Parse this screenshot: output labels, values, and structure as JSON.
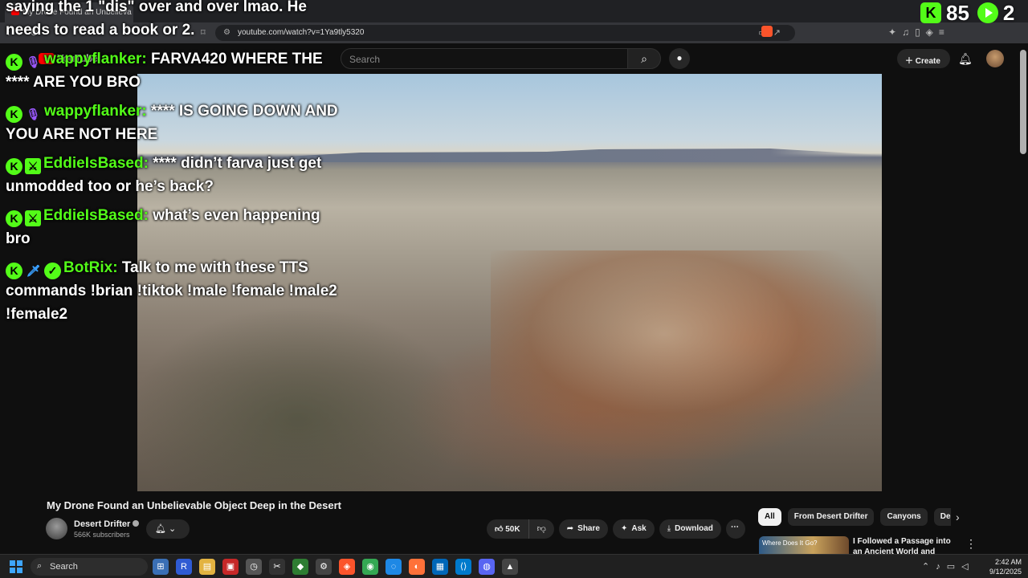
{
  "browser": {
    "tab_title": "My Drone Found an Unbelieva",
    "url": "youtube.com/watch?v=1Ya9tly5320"
  },
  "youtube": {
    "logo_text": "YouTube",
    "search_placeholder": "Search",
    "create_label": "Create"
  },
  "chat": {
    "messages": [
      {
        "badges": [],
        "user": "",
        "text": "saying the 1 \"dis\" over and over lmao. He needs to read a book or 2."
      },
      {
        "badges": [
          "kick-badge",
          "mic-badge"
        ],
        "user": "wappyflanker:",
        "text": "FARVA420 WHERE THE **** ARE YOU BRO"
      },
      {
        "badges": [
          "kick-badge",
          "mic-badge"
        ],
        "user": "wappyflanker:",
        "text": "**** IS GOING DOWN AND YOU ARE NOT HERE"
      },
      {
        "badges": [
          "kick-badge",
          "moderator-badge"
        ],
        "user": "EddieIsBased:",
        "text": "**** didn’t farva just get unmodded too or he’s back?"
      },
      {
        "badges": [
          "kick-badge",
          "moderator-badge"
        ],
        "user": "EddieIsBased:",
        "text": "what’s even happening bro"
      },
      {
        "badges": [
          "kick-badge",
          "sword-badge",
          "verified-badge"
        ],
        "user": "BotRix:",
        "text": "Talk to me with these TTS commands !brian !tiktok !male !female !male2 !female2"
      }
    ]
  },
  "overlay": {
    "viewer_count": "85",
    "second_count": "2"
  },
  "video": {
    "title": "My Drone Found an Unbelievable Object Deep in the Desert",
    "channel_name": "Desert Drifter",
    "subscribers": "566K subscribers",
    "likes": "50K",
    "share_label": "Share",
    "ask_label": "Ask",
    "download_label": "Download"
  },
  "recommendations": {
    "chips": [
      "All",
      "From Desert Drifter",
      "Canyons",
      "Deserts"
    ],
    "first_title": "I Followed a Passage into an Ancient World and Found This",
    "first_thumb_text": "Where Does It Go?"
  },
  "taskbar": {
    "search_label": "Search",
    "time": "2:42 AM",
    "date": "9/12/2025"
  },
  "colors": {
    "kick_green": "#53fc18",
    "youtube_red": "#ff0000",
    "background": "#0f0f0f"
  }
}
